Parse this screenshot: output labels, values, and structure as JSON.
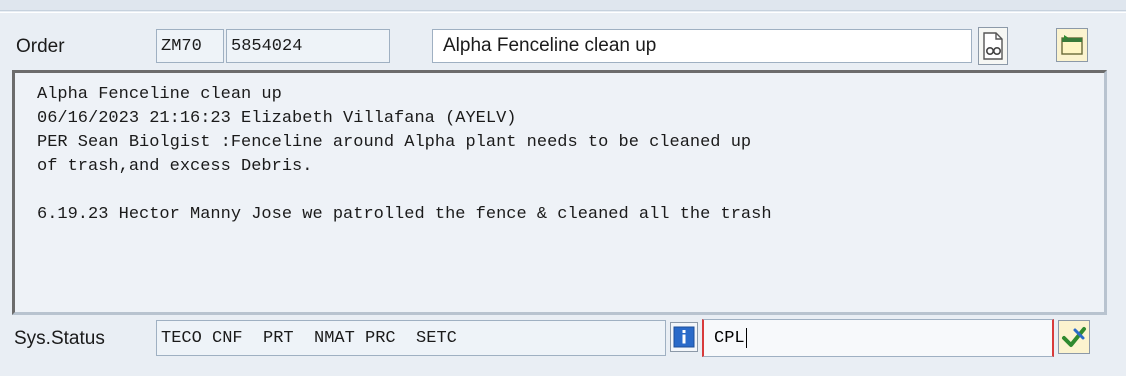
{
  "order": {
    "label": "Order",
    "type": "ZM70",
    "number": "5854024",
    "description": "Alpha Fenceline clean up"
  },
  "long_text": {
    "lines": [
      "Alpha Fenceline clean up",
      "06/16/2023 21:16:23 Elizabeth Villafana (AYELV)",
      "PER Sean Biolgist :Fenceline around Alpha plant needs to be cleaned up",
      "of trash,and excess Debris.",
      "",
      "6.19.23 Hector Manny Jose we patrolled the fence & cleaned all the trash"
    ]
  },
  "sys_status": {
    "label": "Sys.Status",
    "value": "TECO CNF  PRT  NMAT PRC  SETC",
    "user_status": "CPL"
  },
  "icons": {
    "long_text": "display-long-text-icon",
    "navigate": "navigate-icon",
    "info": "info-icon",
    "confirm": "confirm-check-icon"
  },
  "colors": {
    "field_bg": "#eef3f8",
    "required_marker": "#d83b3b",
    "check_green": "#2f8a2f",
    "info_blue": "#2a6ac9"
  }
}
